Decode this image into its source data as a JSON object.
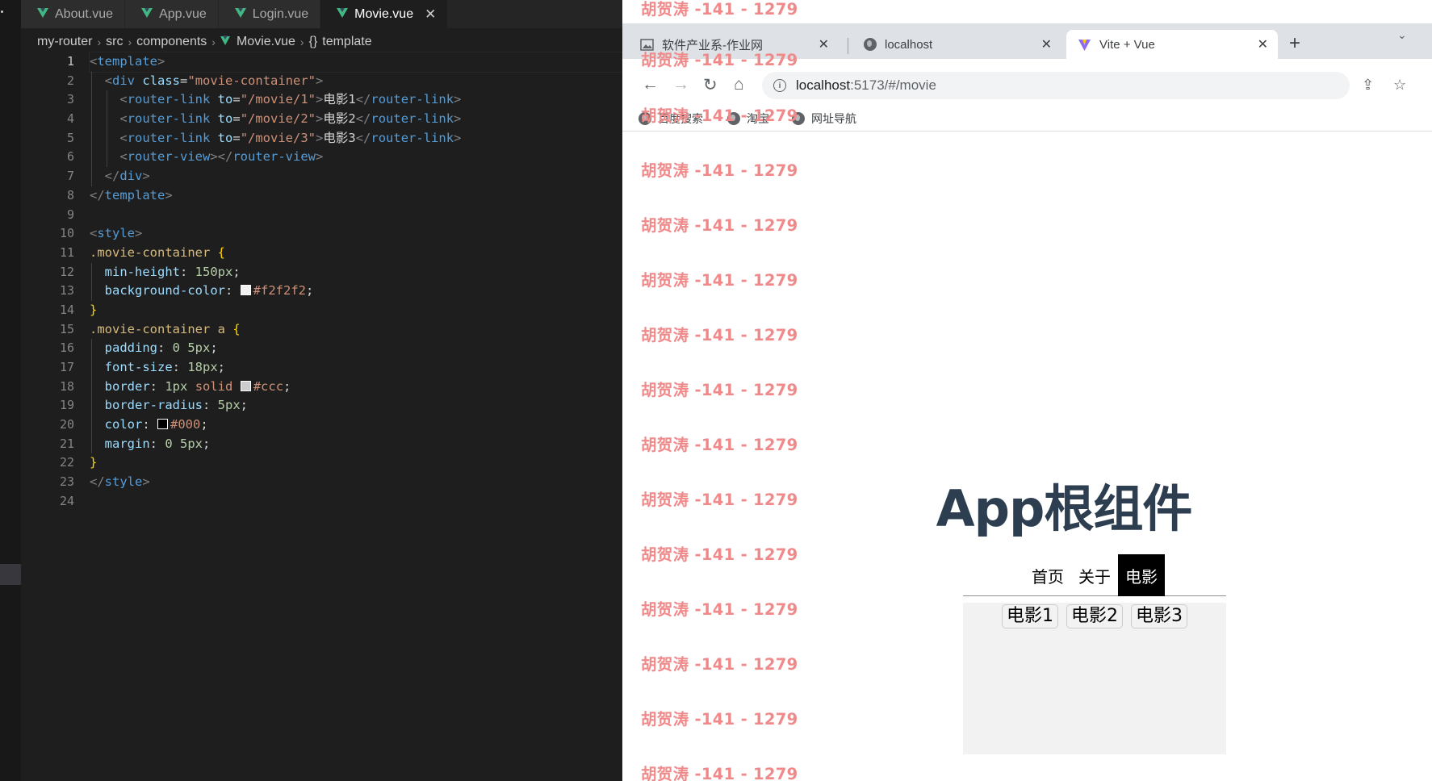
{
  "editor": {
    "tabs": [
      {
        "label": "About.vue"
      },
      {
        "label": "App.vue"
      },
      {
        "label": "Login.vue"
      },
      {
        "label": "Movie.vue"
      }
    ],
    "close_glyph": "✕",
    "breadcrumb": {
      "parts": [
        "my-router",
        "src",
        "components",
        "Movie.vue",
        "template"
      ],
      "braces": "{}"
    },
    "line_numbers": [
      "1",
      "2",
      "3",
      "4",
      "5",
      "6",
      "7",
      "8",
      "9",
      "10",
      "11",
      "12",
      "13",
      "14",
      "15",
      "16",
      "17",
      "18",
      "19",
      "20",
      "21",
      "22",
      "23",
      "24"
    ],
    "code": {
      "l1_tag": "template",
      "l2_tag": "div",
      "l2_attr": "class",
      "l2_val": "\"movie-container\"",
      "l3_tag": "router-link",
      "l3_attr": "to",
      "l3_val": "\"/movie/1\"",
      "l3_text": "电影1",
      "l4_tag": "router-link",
      "l4_attr": "to",
      "l4_val": "\"/movie/2\"",
      "l4_text": "电影2",
      "l5_tag": "router-link",
      "l5_attr": "to",
      "l5_val": "\"/movie/3\"",
      "l5_text": "电影3",
      "l6_tag": "router-view",
      "l7_tag": "div",
      "l8_tag": "template",
      "l10_tag": "style",
      "l11_sel": ".movie-container",
      "l12_prop": "min-height",
      "l12_val": "150px",
      "l13_prop": "background-color",
      "l13_val": "#f2f2f2",
      "l15_sel": ".movie-container a",
      "l16_prop": "padding",
      "l16_val": "0 5px",
      "l17_prop": "font-size",
      "l17_val": "18px",
      "l18_prop": "border",
      "l18_num": "1px",
      "l18_kw": "solid",
      "l18_val": "#ccc",
      "l19_prop": "border-radius",
      "l19_val": "5px",
      "l20_prop": "color",
      "l20_val": "#000",
      "l21_prop": "margin",
      "l21_val": "0 5px",
      "l23_tag": "style"
    }
  },
  "browser": {
    "tabs": [
      {
        "title": "软件产业系-作业网"
      },
      {
        "title": "localhost"
      },
      {
        "title": "Vite + Vue"
      }
    ],
    "close_glyph": "✕",
    "new_tab_glyph": "+",
    "url_host": "localhost",
    "url_path": ":5173/#/movie",
    "bookmarks": [
      "百度搜索",
      "淘宝",
      "网址导航"
    ],
    "watermark": "胡贺涛 -141 - 1279",
    "app_title": "App根组件",
    "nav": [
      "首页",
      "关于",
      "电影"
    ],
    "movie_links": [
      "电影1",
      "电影2",
      "电影3"
    ]
  },
  "colors": {
    "editor_bg": "#1e1e1e",
    "vue_green": "#41b883",
    "watermark": "#f08a8a",
    "app_title": "#2c3e50",
    "movie_bg": "#f2f2f2"
  }
}
